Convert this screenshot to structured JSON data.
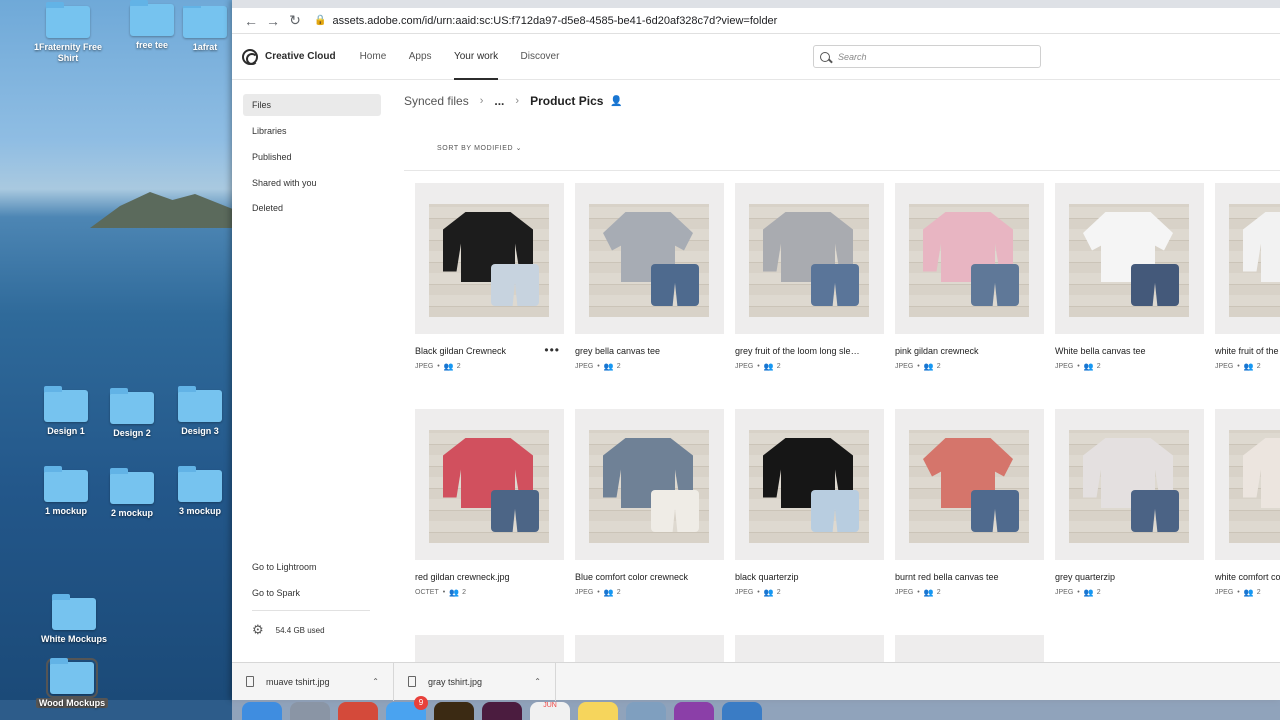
{
  "desktop": {
    "items": [
      {
        "label": "1Fraternity Free Shirt"
      },
      {
        "label": "free tee"
      },
      {
        "label": "1afrat"
      },
      {
        "label": "Design 1"
      },
      {
        "label": "Design 2"
      },
      {
        "label": "Design 3"
      },
      {
        "label": "1 mockup"
      },
      {
        "label": "2 mockup"
      },
      {
        "label": "3 mockup"
      },
      {
        "label": "White Mockups"
      },
      {
        "label": "Wood Mockups"
      }
    ]
  },
  "browser": {
    "url": "assets.adobe.com/id/urn:aaid:sc:US:f712da97-d5e8-4585-be41-6d20af328c7d?view=folder"
  },
  "app": {
    "brand": "Creative Cloud",
    "nav": [
      "Home",
      "Apps",
      "Your work",
      "Discover"
    ],
    "active_nav": "Your work",
    "search_placeholder": "Search"
  },
  "sidebar": {
    "items": [
      "Files",
      "Libraries",
      "Published",
      "Shared with you",
      "Deleted"
    ],
    "links": [
      "Go to Lightroom",
      "Go to Spark"
    ],
    "storage": "54.4 GB used"
  },
  "breadcrumb": {
    "root": "Synced files",
    "ellipsis": "...",
    "current": "Product Pics"
  },
  "sort_label": "SORT BY  MODIFIED",
  "files": [
    {
      "name": "Black gildan Crewneck",
      "type": "JPEG",
      "collab": "2",
      "garment": "#1c1c1c",
      "style": "sweater",
      "shorts": "#c7d3df"
    },
    {
      "name": "grey bella canvas tee",
      "type": "JPEG",
      "collab": "2",
      "garment": "#a7acb4",
      "style": "tee",
      "shorts": "#4e6a8e"
    },
    {
      "name": "grey fruit of the loom long sleeve",
      "type": "JPEG",
      "collab": "2",
      "garment": "#a9abb0",
      "style": "sweater",
      "shorts": "#5a7599"
    },
    {
      "name": "pink gildan crewneck",
      "type": "JPEG",
      "collab": "2",
      "garment": "#e8b5c2",
      "style": "sweater",
      "shorts": "#5f7898"
    },
    {
      "name": "White bella canvas tee",
      "type": "JPEG",
      "collab": "2",
      "garment": "#f5f5f5",
      "style": "tee",
      "shorts": "#44597a"
    },
    {
      "name": "white fruit of the loom",
      "type": "JPEG",
      "collab": "2",
      "garment": "#f2f2f2",
      "style": "sweater",
      "shorts": "#5e7699"
    },
    {
      "name": "red gildan crewneck.jpg",
      "type": "OCTET",
      "collab": "2",
      "garment": "#d1505e",
      "style": "sweater",
      "shorts": "#4c6586"
    },
    {
      "name": "Blue comfort color crewneck",
      "type": "JPEG",
      "collab": "2",
      "garment": "#6f8196",
      "style": "sweater",
      "shorts": "#efece6"
    },
    {
      "name": "black quarterzip",
      "type": "JPEG",
      "collab": "2",
      "garment": "#161616",
      "style": "sweater",
      "shorts": "#b8cde0"
    },
    {
      "name": "burnt red bella canvas tee",
      "type": "JPEG",
      "collab": "2",
      "garment": "#d5756b",
      "style": "tee",
      "shorts": "#4f6a8e"
    },
    {
      "name": "grey quarterzip",
      "type": "JPEG",
      "collab": "2",
      "garment": "#e4e0e0",
      "style": "sweater",
      "shorts": "#4b6385"
    },
    {
      "name": "white comfort colors",
      "type": "JPEG",
      "collab": "2",
      "garment": "#ece5df",
      "style": "sweater",
      "shorts": "#5e7598"
    }
  ],
  "downloads": [
    {
      "name": "muave tshirt.jpg"
    },
    {
      "name": "gray tshirt.jpg"
    }
  ],
  "dock": {
    "badge": "9",
    "calendar_month": "JUN"
  }
}
